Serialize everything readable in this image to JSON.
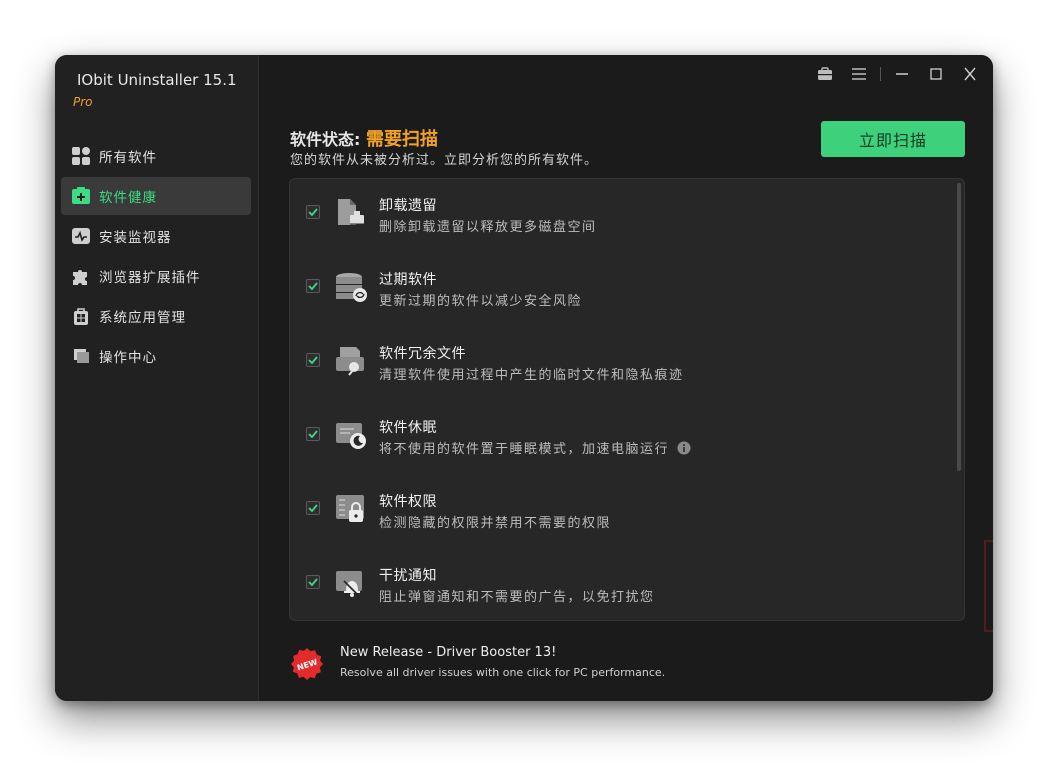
{
  "app": {
    "title": "IObit Uninstaller 15.1",
    "edition": "Pro"
  },
  "sidebar": {
    "items": [
      {
        "label": "所有软件",
        "icon": "grid-icon",
        "active": false
      },
      {
        "label": "软件健康",
        "icon": "health-kit-icon",
        "active": true
      },
      {
        "label": "安装监视器",
        "icon": "monitor-icon",
        "active": false
      },
      {
        "label": "浏览器扩展插件",
        "icon": "puzzle-icon",
        "active": false
      },
      {
        "label": "系统应用管理",
        "icon": "windows-bag-icon",
        "active": false
      },
      {
        "label": "操作中心",
        "icon": "flag-icon",
        "active": false
      }
    ]
  },
  "header": {
    "status_label": "软件状态: ",
    "status_value": "需要扫描",
    "status_sub": "您的软件从未被分析过。立即分析您的所有软件。",
    "scan_button": "立即扫描"
  },
  "items": [
    {
      "title": "卸载遗留",
      "desc": "删除卸载遗留以释放更多磁盘空间",
      "checked": true,
      "icon": "residual-files-icon"
    },
    {
      "title": "过期软件",
      "desc": "更新过期的软件以减少安全风险",
      "checked": true,
      "icon": "outdated-software-icon"
    },
    {
      "title": "软件冗余文件",
      "desc": "清理软件使用过程中产生的临时文件和隐私痕迹",
      "checked": true,
      "icon": "junk-files-icon"
    },
    {
      "title": "软件休眠",
      "desc": "将不使用的软件置于睡眠模式，加速电脑运行",
      "checked": true,
      "icon": "sleep-mode-icon"
    },
    {
      "title": "软件权限",
      "desc": "检测隐藏的权限并禁用不需要的权限",
      "checked": true,
      "icon": "permission-lock-icon"
    },
    {
      "title": "干扰通知",
      "desc": "阻止弹窗通知和不需要的广告，以免打扰您",
      "checked": true,
      "icon": "notification-block-icon"
    }
  ],
  "promo": {
    "badge": "NEW",
    "title": "New Release - Driver Booster 13!",
    "subtitle": "Resolve all driver issues with one click for PC performance."
  },
  "colors": {
    "accent_green": "#3dd17c",
    "status_orange": "#f3a126",
    "edition_orange": "#f0a030"
  }
}
